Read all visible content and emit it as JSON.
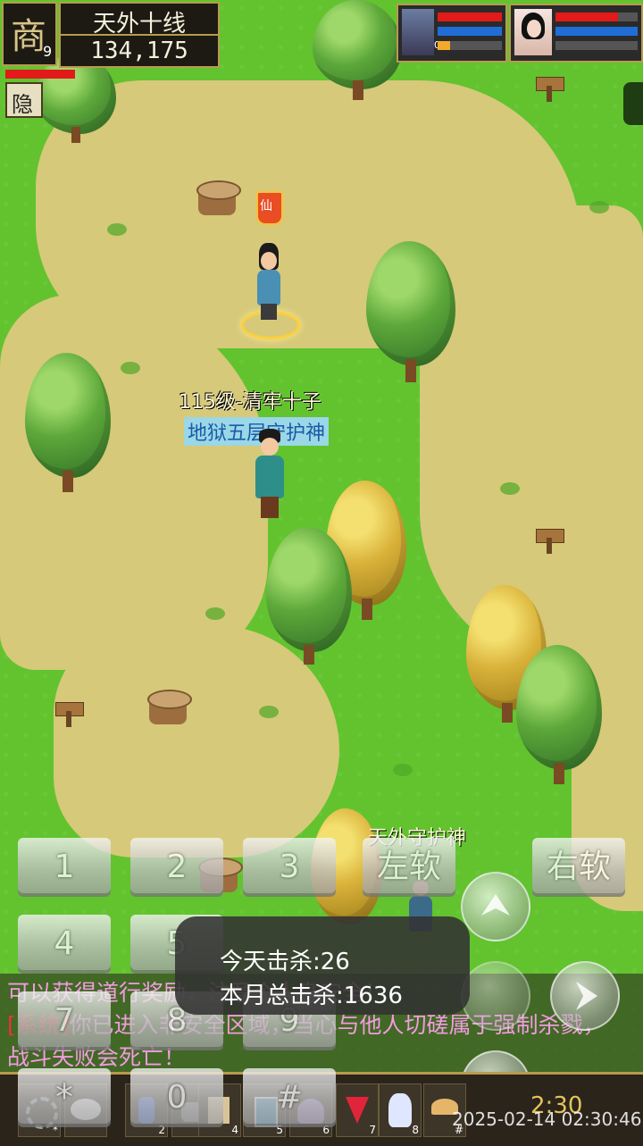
{
  "player": {
    "server_name": "天外十线",
    "coords": "134,175",
    "emblem_glyph": "商",
    "emblem_level": "9",
    "hide_label": "隐"
  },
  "party": [
    {
      "icon": "soldier-portrait-icon",
      "level": "0"
    },
    {
      "icon": "lady-portrait-icon",
      "level": ""
    }
  ],
  "world": {
    "banner_glyph": "仙",
    "player_level_name": "115级-清牢十子",
    "player_title": "地狱五层守护神",
    "npc_name": "天外守护神"
  },
  "keypad": {
    "keys": [
      "1",
      "2",
      "3",
      "4",
      "5",
      "7",
      "8",
      "9",
      "*",
      "0",
      "#"
    ],
    "left_soft": "左软",
    "right_soft": "右软"
  },
  "chat": {
    "line1": "可以获得道行奖励，注意个人身安全！",
    "line2_tag": "[系统]",
    "line2_text": "你已进入非安全区域，当心与他人切磋属于强制杀戮，",
    "line3": "战斗失败会死亡！"
  },
  "toast": {
    "today_kills": "今天击杀:26",
    "month_kills": "本月总击杀:1636"
  },
  "bottom_bar": {
    "slots": [
      {
        "icon": "gear-icon",
        "num": "*"
      },
      {
        "icon": "chat-icon",
        "num": ""
      },
      {
        "icon": "potion-icon",
        "num": "2"
      },
      {
        "icon": "pot-icon",
        "num": "3"
      },
      {
        "icon": "scroll-icon",
        "num": "4"
      },
      {
        "icon": "book-icon",
        "num": "5"
      },
      {
        "icon": "ghost-icon",
        "num": "6"
      },
      {
        "icon": "flag-icon",
        "num": "7"
      },
      {
        "icon": "rabbit-icon",
        "num": "8"
      },
      {
        "icon": "mushroom-icon",
        "num": "#"
      }
    ],
    "clock": "2:30",
    "timestamp": "2025-02-14 02:30:46"
  }
}
